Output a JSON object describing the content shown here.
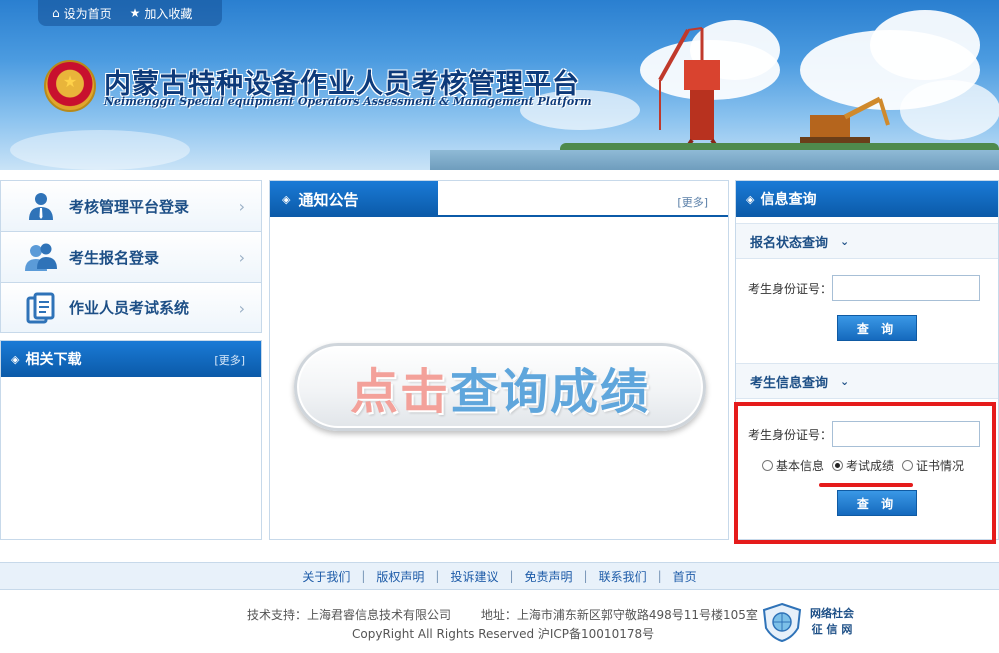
{
  "topbar": {
    "set_home": "设为首页",
    "add_favorite": "加入收藏"
  },
  "header": {
    "title": "内蒙古特种设备作业人员考核管理平台",
    "subtitle": "Neimenggu Special equipment Operators Assessment & Management Platform"
  },
  "left_menu": {
    "items": [
      {
        "label": "考核管理平台登录",
        "icon": "person-icon"
      },
      {
        "label": "考生报名登录",
        "icon": "users-icon"
      },
      {
        "label": "作业人员考试系统",
        "icon": "document-icon"
      }
    ]
  },
  "downloads": {
    "title": "相关下载",
    "more": "[更多]"
  },
  "notices": {
    "title": "通知公告",
    "more": "[更多]"
  },
  "score_query_button": {
    "part1": "点击",
    "part2": "查询成绩"
  },
  "info_query": {
    "title": "信息查询",
    "registration": {
      "title": "报名状态查询",
      "id_label": "考生身份证号：",
      "id_value": "",
      "button": "查 询"
    },
    "candidate": {
      "title": "考生信息查询",
      "id_label": "考生身份证号：",
      "id_value": "",
      "options": [
        "基本信息",
        "考试成绩",
        "证书情况"
      ],
      "selected": "考试成绩",
      "button": "查 询"
    }
  },
  "footer": {
    "links": [
      "关于我们",
      "版权声明",
      "投诉建议",
      "免责声明",
      "联系我们",
      "首页"
    ],
    "tech_support": "技术支持：上海君睿信息技术有限公司",
    "address": "地址：上海市浦东新区郭守敬路498号11号楼105室",
    "copyright": "CopyRight All Rights Reserved   沪ICP备10010178号",
    "badge_line1": "网络社会",
    "badge_line2": "征 信 网"
  },
  "colors": {
    "primary_blue": "#0b5aa8",
    "highlight_red": "#e51b1b",
    "link_blue": "#1d5ba8"
  }
}
